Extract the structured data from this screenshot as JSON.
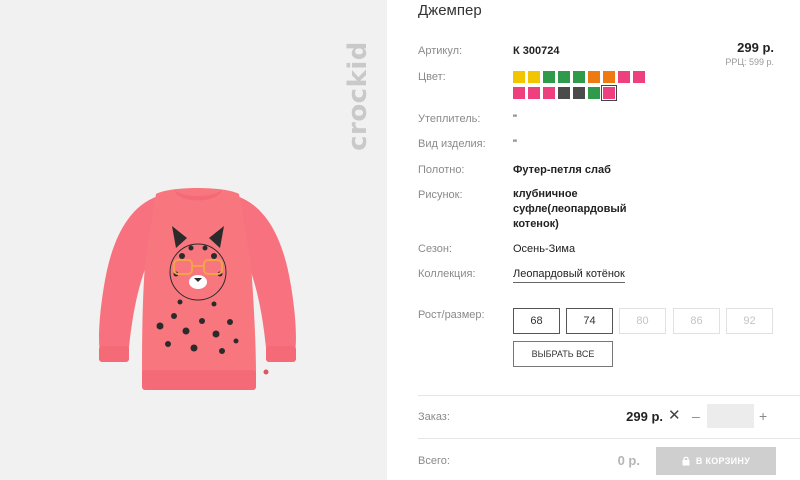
{
  "gallery": {
    "brand": "crockid"
  },
  "product": {
    "title": "Джемпер",
    "article_label": "Артикул:",
    "article": "К 300724",
    "price": "299 р.",
    "rrp": "РРЦ: 599 р.",
    "color_label": "Цвет:",
    "swatches": [
      {
        "name": "yellow",
        "color": "#f3c500"
      },
      {
        "name": "yellow-2",
        "color": "#f3c500"
      },
      {
        "name": "green",
        "color": "#2f9a4a"
      },
      {
        "name": "green-2",
        "color": "#2f9a4a"
      },
      {
        "name": "green-3",
        "color": "#2f9a4a"
      },
      {
        "name": "orange",
        "color": "#f07a12"
      },
      {
        "name": "orange-2",
        "color": "#f07a12"
      },
      {
        "name": "pink",
        "color": "#ee3f7e"
      },
      {
        "name": "pink-2",
        "color": "#ee3f7e"
      },
      {
        "name": "pink-3",
        "color": "#ee3f7e"
      },
      {
        "name": "pink-4",
        "color": "#ee3f7e"
      },
      {
        "name": "pink-5",
        "color": "#ee3f7e"
      },
      {
        "name": "dark-grey",
        "color": "#4b4b4b"
      },
      {
        "name": "dark-grey-2",
        "color": "#4b4b4b"
      },
      {
        "name": "green-4",
        "color": "#2f9a4a"
      },
      {
        "name": "pink-selected",
        "color": "#ee3f7e",
        "selected": true
      }
    ],
    "insulation_label": "Утеплитель:",
    "insulation": "\"",
    "type_label": "Вид изделия:",
    "type": "\"",
    "fabric_label": "Полотно:",
    "fabric": "Футер-петля слаб",
    "print_label": "Рисунок:",
    "print": "клубничное суфле(леопардовый котенок)",
    "season_label": "Сезон:",
    "season": "Осень-Зима",
    "collection_label": "Коллекция:",
    "collection": "Леопардовый котёнок",
    "size_label": "Рост/размер:",
    "sizes": [
      {
        "label": "68",
        "available": true
      },
      {
        "label": "74",
        "available": true
      },
      {
        "label": "80",
        "available": false
      },
      {
        "label": "86",
        "available": false
      },
      {
        "label": "92",
        "available": false
      }
    ],
    "select_all": "ВЫБРАТЬ ВСЕ"
  },
  "order": {
    "label": "Заказ:",
    "price": "299 р.",
    "quantity": "",
    "minus": "–",
    "plus": "+"
  },
  "total": {
    "label": "Всего:",
    "price": "0 р.",
    "cart_button": "В КОРЗИНУ"
  },
  "colors": {
    "accent_pink": "#f7727e",
    "muted_button": "#cfcfcf"
  }
}
